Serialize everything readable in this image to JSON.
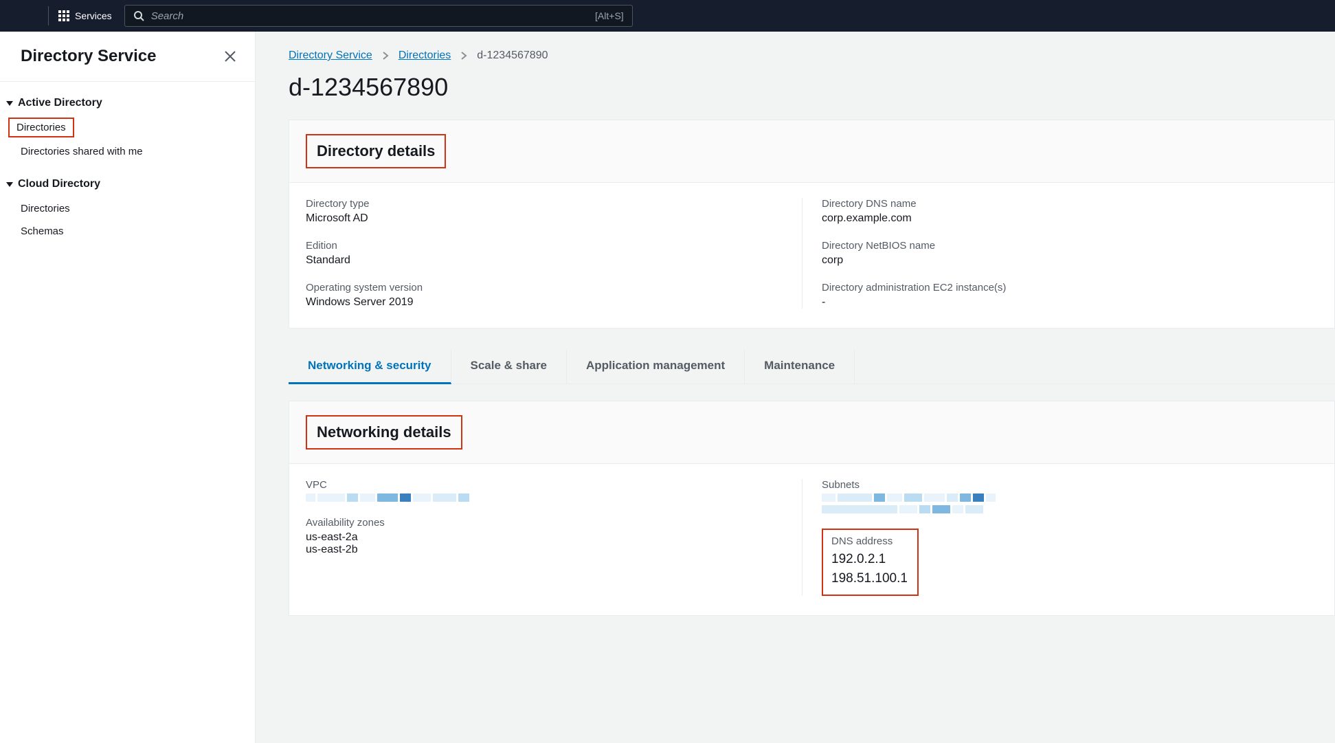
{
  "topnav": {
    "services_label": "Services",
    "search_placeholder": "Search",
    "search_shortcut": "[Alt+S]"
  },
  "sidebar": {
    "title": "Directory Service",
    "groups": [
      {
        "title": "Active Directory",
        "items": [
          {
            "label": "Directories",
            "highlighted": true
          },
          {
            "label": "Directories shared with me"
          }
        ]
      },
      {
        "title": "Cloud Directory",
        "items": [
          {
            "label": "Directories"
          },
          {
            "label": "Schemas"
          }
        ]
      }
    ]
  },
  "breadcrumb": {
    "root": "Directory Service",
    "mid": "Directories",
    "current": "d-1234567890"
  },
  "page": {
    "title": "d-1234567890"
  },
  "details_panel": {
    "heading": "Directory details",
    "left": [
      {
        "label": "Directory type",
        "value": "Microsoft AD"
      },
      {
        "label": "Edition",
        "value": "Standard"
      },
      {
        "label": "Operating system version",
        "value": "Windows Server 2019"
      }
    ],
    "right": [
      {
        "label": "Directory DNS name",
        "value": "corp.example.com"
      },
      {
        "label": "Directory NetBIOS name",
        "value": "corp"
      },
      {
        "label": "Directory administration EC2 instance(s)",
        "value": "-"
      }
    ]
  },
  "tabs": [
    {
      "label": "Networking & security",
      "active": true
    },
    {
      "label": "Scale & share"
    },
    {
      "label": "Application management"
    },
    {
      "label": "Maintenance"
    }
  ],
  "networking_panel": {
    "heading": "Networking details",
    "vpc_label": "VPC",
    "az_label": "Availability zones",
    "az_values": [
      "us-east-2a",
      "us-east-2b"
    ],
    "subnets_label": "Subnets",
    "dns_label": "DNS address",
    "dns_values": [
      "192.0.2.1",
      "198.51.100.1"
    ]
  }
}
